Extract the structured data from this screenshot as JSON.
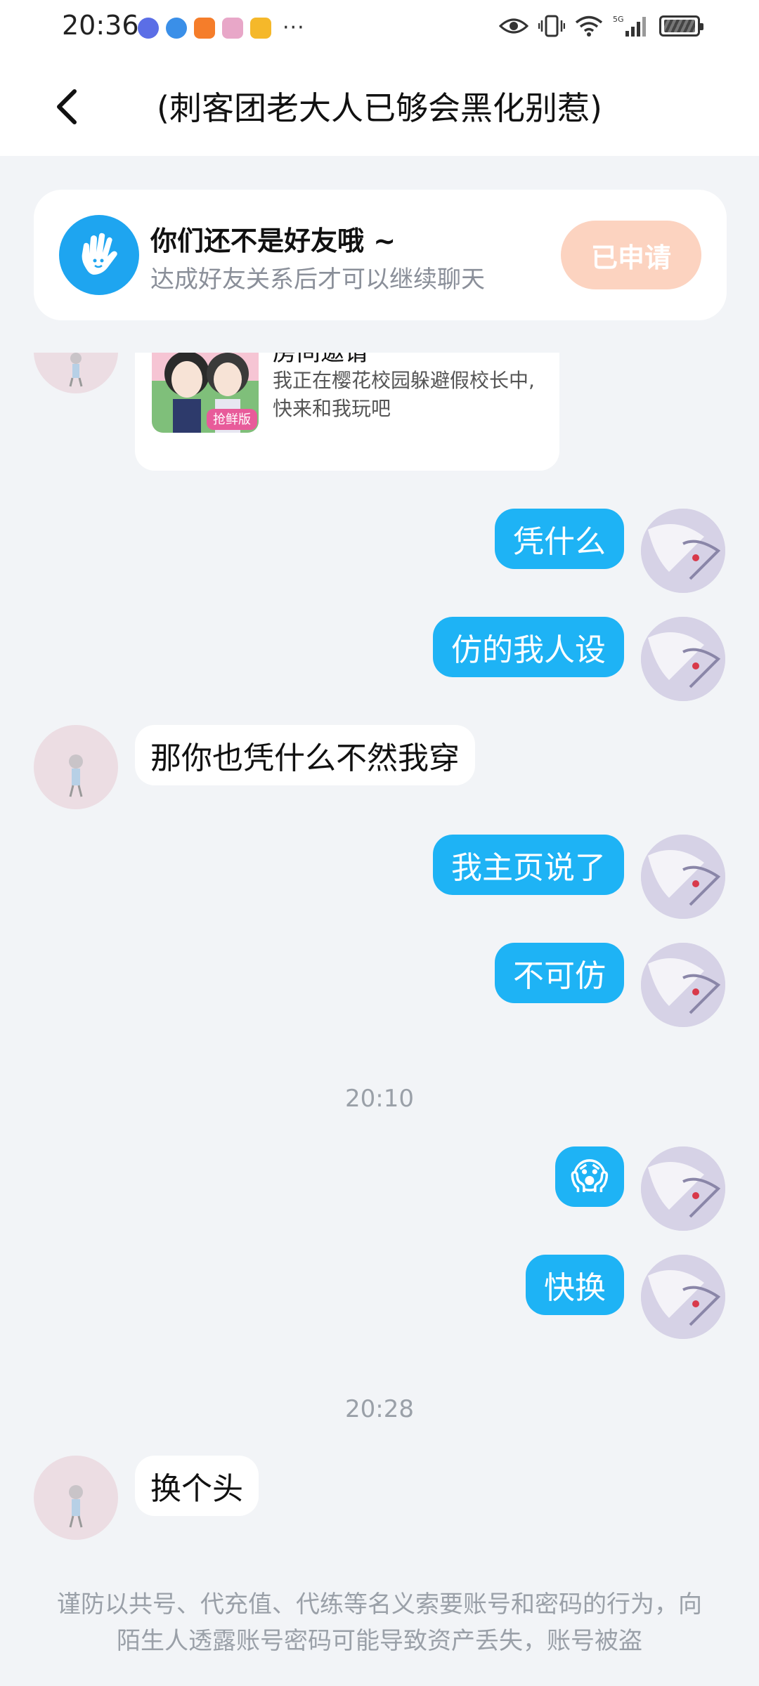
{
  "status_bar": {
    "time": "20:36",
    "more": "···",
    "network": "5G"
  },
  "header": {
    "title": "(刺客团老大人已够会黑化别惹)"
  },
  "friend_card": {
    "title": "你们还不是好友哦 ~",
    "subtitle": "达成好友关系后才可以继续聊天",
    "button": "已申请"
  },
  "invite": {
    "title": "房间邀请",
    "description": "我正在樱花校园躲避假校长中, 快来和我玩吧",
    "thumb_badge": "抢鲜版"
  },
  "messages": [
    {
      "side": "right",
      "text": "凭什么"
    },
    {
      "side": "right",
      "text": "仿的我人设"
    },
    {
      "side": "left",
      "text": "那你也凭什么不然我穿"
    },
    {
      "side": "right",
      "text": "我主页说了"
    },
    {
      "side": "right",
      "text": "不可仿"
    },
    {
      "side": "time",
      "text": "20:10"
    },
    {
      "side": "right",
      "text": "😱"
    },
    {
      "side": "right",
      "text": "快换"
    },
    {
      "side": "time",
      "text": "20:28"
    },
    {
      "side": "left",
      "text": "换个头"
    }
  ],
  "notice": "谨防以共号、代充值、代练等名义索要账号和密码的行为，向陌生人透露账号密码可能导致资产丢失，账号被盗",
  "colors": {
    "self_bubble": "#1eb3f5",
    "apply_button": "#fcd3c0",
    "wave_icon": "#1ea5f0"
  }
}
